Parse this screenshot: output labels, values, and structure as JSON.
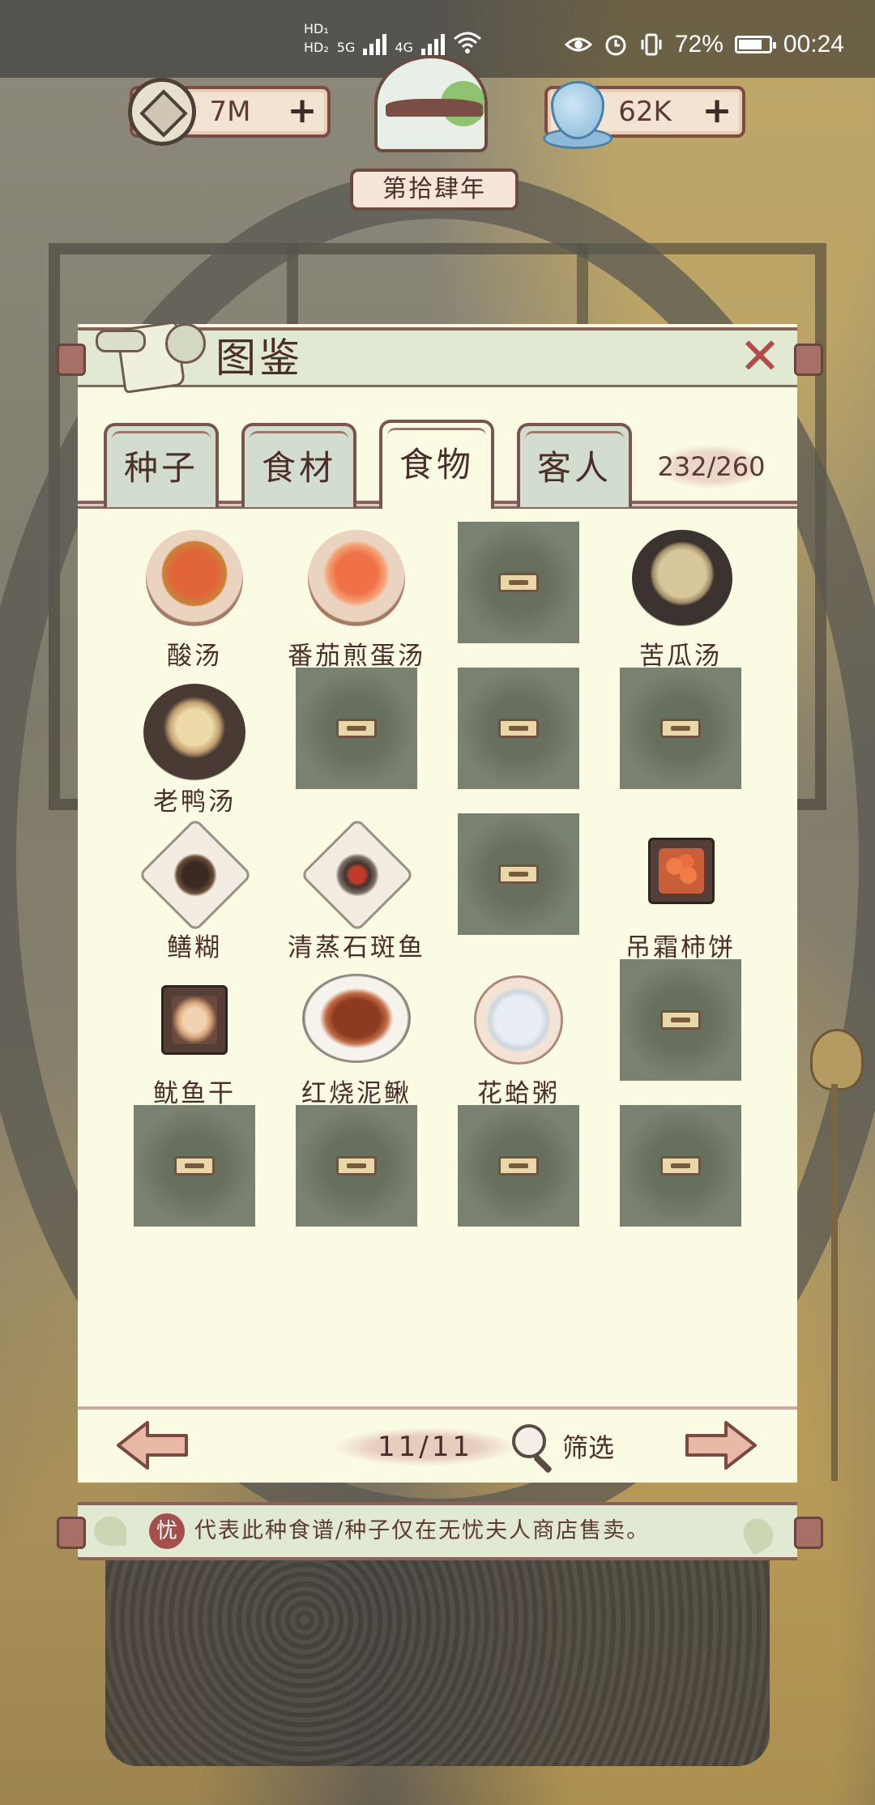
{
  "status_bar": {
    "hd1": "HD₁",
    "hd2": "HD₂",
    "net1": "5G",
    "net2": "4G",
    "battery_pct": "72%",
    "time": "00:24",
    "icons": [
      "eye-icon",
      "alarm-icon",
      "vibrate-icon",
      "wifi-icon",
      "battery-icon"
    ]
  },
  "hud": {
    "coins": "7M",
    "water": "62K",
    "plus": "+",
    "year": "第拾肆年"
  },
  "panel": {
    "title": "图鉴",
    "close": "✕",
    "count": "232/260",
    "tabs": [
      {
        "label": "种子",
        "active": false
      },
      {
        "label": "食材",
        "active": false
      },
      {
        "label": "食物",
        "active": true
      },
      {
        "label": "客人",
        "active": false
      }
    ]
  },
  "grid": {
    "items": [
      {
        "name": "酸汤",
        "unlocked": true,
        "icon": "sour-soup-bowl"
      },
      {
        "name": "番茄煎蛋汤",
        "unlocked": true,
        "icon": "tomato-egg-soup-bowl"
      },
      {
        "name": "",
        "unlocked": false
      },
      {
        "name": "苦瓜汤",
        "unlocked": true,
        "icon": "bitter-melon-soup-pot"
      },
      {
        "name": "老鸭汤",
        "unlocked": true,
        "icon": "old-duck-soup-pot"
      },
      {
        "name": "",
        "unlocked": false
      },
      {
        "name": "",
        "unlocked": false
      },
      {
        "name": "",
        "unlocked": false
      },
      {
        "name": "鳝糊",
        "unlocked": true,
        "icon": "eel-paste-plate"
      },
      {
        "name": "清蒸石斑鱼",
        "unlocked": true,
        "icon": "steamed-grouper-plate"
      },
      {
        "name": "",
        "unlocked": false
      },
      {
        "name": "吊霜柿饼",
        "unlocked": true,
        "icon": "frosted-persimmon-dish"
      },
      {
        "name": "鱿鱼干",
        "unlocked": true,
        "icon": "dried-squid-dish"
      },
      {
        "name": "红烧泥鳅",
        "unlocked": true,
        "icon": "braised-loach-plate"
      },
      {
        "name": "花蛤粥",
        "unlocked": true,
        "icon": "clam-congee-bowl"
      },
      {
        "name": "",
        "unlocked": false
      },
      {
        "name": "",
        "unlocked": false
      },
      {
        "name": "",
        "unlocked": false
      },
      {
        "name": "",
        "unlocked": false
      },
      {
        "name": "",
        "unlocked": false
      }
    ]
  },
  "footer": {
    "page": "11/11",
    "filter": "筛选"
  },
  "notice": {
    "badge": "忧",
    "text": "代表此种食谱/种子仅在无忧夫人商店售卖。"
  },
  "colors": {
    "panel_bg": "#fbfbe3",
    "header_bg": "#e1e9d2",
    "border": "#8a6358",
    "locked_tile": "#7b8271",
    "text": "#4b2e2a",
    "close_red": "#b54a4a"
  }
}
